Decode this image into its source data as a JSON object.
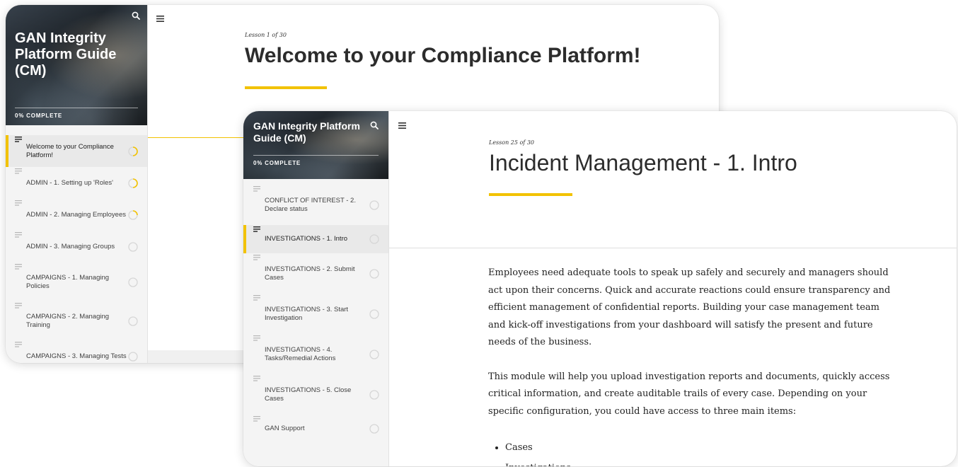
{
  "back_window": {
    "course_title": "GAN Integrity Platform Guide (CM)",
    "progress_text": "0% COMPLETE",
    "lessons": [
      {
        "label": "Welcome to your Compliance Platform!",
        "status": "in-progress",
        "active": true
      },
      {
        "label": "ADMIN - 1. Setting up 'Roles'",
        "status": "in-progress"
      },
      {
        "label": "ADMIN - 2. Managing Employees",
        "status": "in-progress"
      },
      {
        "label": "ADMIN - 3. Managing Groups",
        "status": "not-started"
      },
      {
        "label": "CAMPAIGNS - 1. Managing Policies",
        "status": "not-started"
      },
      {
        "label": "CAMPAIGNS - 2. Managing Training",
        "status": "not-started"
      },
      {
        "label": "CAMPAIGNS - 3. Managing Tests",
        "status": "not-started"
      }
    ],
    "lesson_counter": "Lesson 1 of 30",
    "lesson_title": "Welcome to your Compliance Platform!"
  },
  "front_window": {
    "course_title": "GAN Integrity Platform Guide (CM)",
    "progress_text": "0% COMPLETE",
    "lessons": [
      {
        "label": "CONFLICT OF INTEREST - 2. Declare status",
        "status": "not-started"
      },
      {
        "label": "INVESTIGATIONS - 1. Intro",
        "status": "not-started",
        "active": true
      },
      {
        "label": "INVESTIGATIONS - 2. Submit Cases",
        "status": "not-started"
      },
      {
        "label": "INVESTIGATIONS - 3. Start Investigation",
        "status": "not-started"
      },
      {
        "label": "INVESTIGATIONS - 4. Tasks/Remedial Actions",
        "status": "not-started"
      },
      {
        "label": "INVESTIGATIONS - 5. Close Cases",
        "status": "not-started"
      },
      {
        "label": "GAN Support",
        "status": "not-started"
      }
    ],
    "lesson_counter": "Lesson 25 of 30",
    "lesson_title": "Incident Management - 1. Intro",
    "body": {
      "paragraphs": [
        "Employees need adequate tools to speak up safely and securely and managers should act upon their concerns. Quick and accurate reactions could ensure transparency and efficient management of confidential reports. Building your case management team and kick-off investigations from your dashboard will satisfy the present and future needs of the business.",
        "This module will help you upload investigation reports and documents, quickly access critical information, and create auditable trails of every case. Depending on your specific configuration, you could have access to three main items:"
      ],
      "bullets": [
        "Cases",
        "Investigations"
      ]
    }
  },
  "colors": {
    "accent": "#f2c200",
    "sidebar_bg": "#f4f4f4",
    "active_item_bg": "#e9e9e9",
    "text_dark": "#2c2c2c"
  },
  "icons": {
    "search": "search-icon",
    "menu": "hamburger-menu-icon",
    "lesson": "lesson-lines-icon",
    "status_in_progress": "progress-ring-icon",
    "status_not_started": "empty-circle-icon"
  }
}
